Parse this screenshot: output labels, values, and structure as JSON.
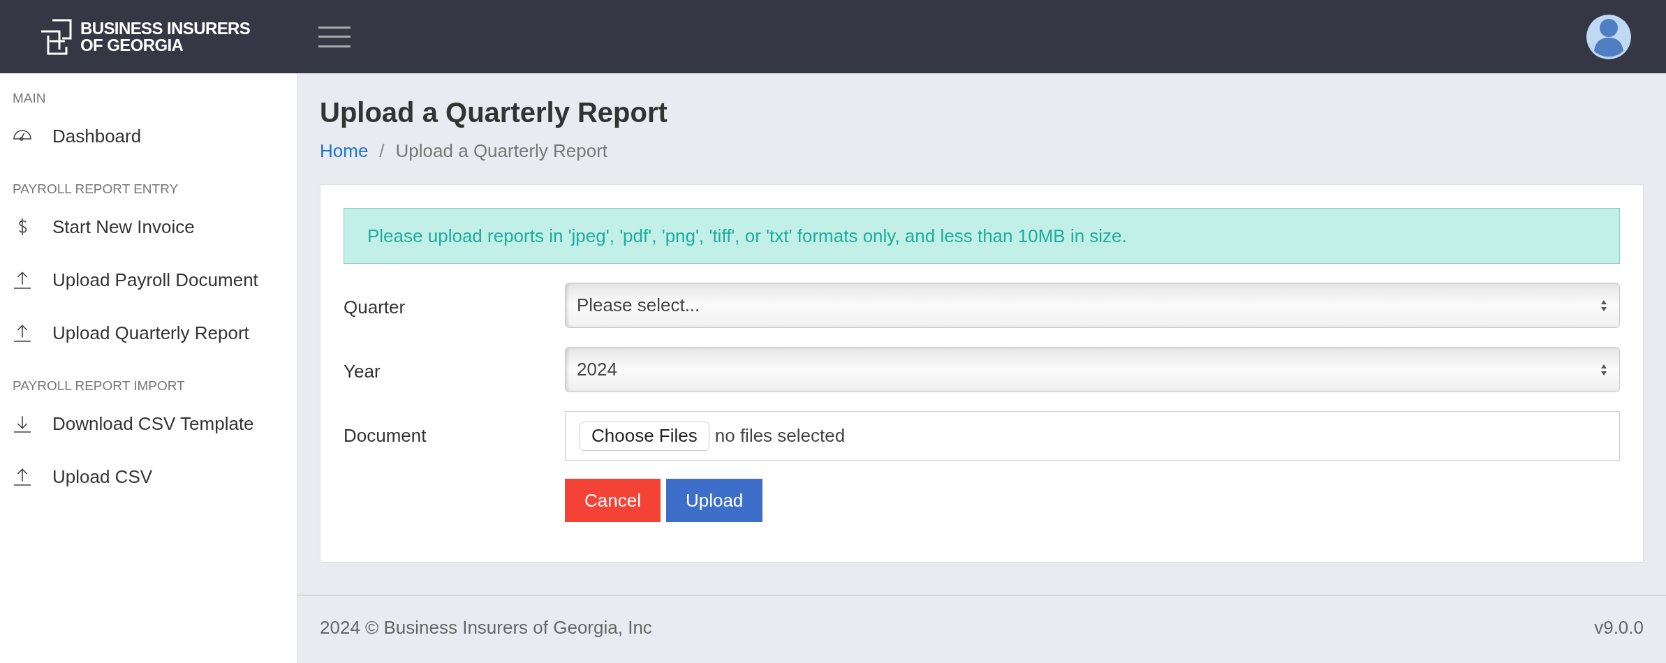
{
  "header": {
    "logo_lines": [
      "BUSINESS INSURERS",
      "OF GEORGIA"
    ]
  },
  "sidebar": {
    "sections": [
      {
        "title": "MAIN",
        "items": [
          {
            "label": "Dashboard",
            "kind": "gauge"
          }
        ]
      },
      {
        "title": "PAYROLL REPORT ENTRY",
        "items": [
          {
            "label": "Start New Invoice",
            "kind": "dollar"
          },
          {
            "label": "Upload Payroll Document",
            "kind": "upload"
          },
          {
            "label": "Upload Quarterly Report",
            "kind": "upload"
          }
        ]
      },
      {
        "title": "PAYROLL REPORT IMPORT",
        "items": [
          {
            "label": "Download CSV Template",
            "kind": "download"
          },
          {
            "label": "Upload CSV",
            "kind": "upload"
          }
        ]
      }
    ]
  },
  "page": {
    "title": "Upload a Quarterly Report",
    "breadcrumb": [
      {
        "label": "Home",
        "kind": "link"
      },
      {
        "label": "/",
        "kind": "separator"
      },
      {
        "label": "Upload a Quarterly Report",
        "kind": "current"
      }
    ]
  },
  "alert": "Please upload reports in 'jpeg', 'pdf', 'png', 'tiff', or 'txt' formats only, and less than 10MB in size.",
  "form": {
    "fields": [
      {
        "label": "Quarter",
        "kind": "select",
        "value": "Please select..."
      },
      {
        "label": "Year",
        "kind": "select",
        "value": "2024"
      },
      {
        "label": "Document",
        "kind": "file",
        "button": "Choose Files",
        "value": "no files selected"
      }
    ],
    "buttons": [
      {
        "label": "Cancel",
        "kind": "danger"
      },
      {
        "label": "Upload",
        "kind": "primary"
      }
    ]
  },
  "footer": {
    "copyright": "2024 © Business Insurers of Georgia, Inc",
    "version": "v9.0.0"
  }
}
